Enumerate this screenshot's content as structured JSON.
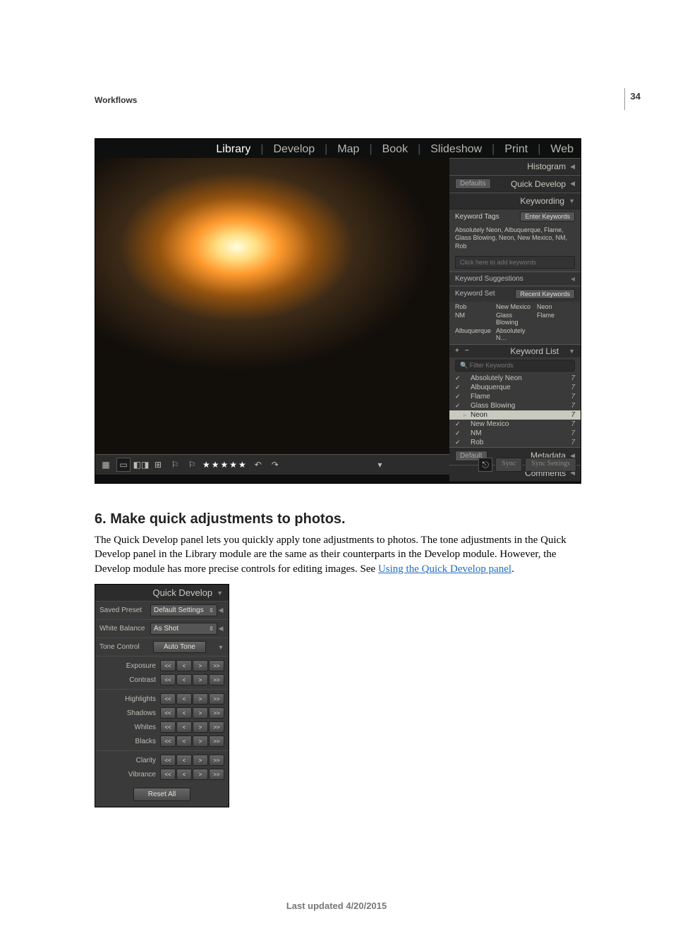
{
  "pagenum": "34",
  "eyebrow": "Workflows",
  "modules": {
    "items": [
      "Library",
      "Develop",
      "Map",
      "Book",
      "Slideshow",
      "Print",
      "Web"
    ],
    "selected": "Library",
    "sep": "|"
  },
  "rpanels": {
    "histogram": {
      "title": "Histogram",
      "tri": "◀"
    },
    "quickdev": {
      "title": "Quick Develop",
      "left_label": "Defaults",
      "tri": "◀"
    },
    "keywording": {
      "title": "Keywording",
      "tri": "▼",
      "tags_label": "Keyword Tags",
      "enter_btn": "Enter Keywords",
      "applied": "Absolutely Neon, Albuquerque, Flame, Glass Blowing, Neon, New Mexico, NM, Rob",
      "add_placeholder": "Click here to add keywords",
      "suggestions_label": "Keyword Suggestions",
      "set_label": "Keyword Set",
      "set_btn": "Recent Keywords",
      "set_items": [
        "Rob",
        "New Mexico",
        "Neon",
        "NM",
        "Glass Blowing",
        "Flame",
        "Albuquerque",
        "Absolutely N…",
        ""
      ]
    },
    "keywordlist": {
      "title": "Keyword List",
      "tri": "▼",
      "plus": "+",
      "minus": "−",
      "filter_placeholder": "Filter Keywords",
      "items": [
        {
          "name": "Absolutely Neon",
          "count": "7",
          "checked": true,
          "sel": false
        },
        {
          "name": "Albuquerque",
          "count": "7",
          "checked": true,
          "sel": false
        },
        {
          "name": "Flame",
          "count": "7",
          "checked": true,
          "sel": false
        },
        {
          "name": "Glass Blowing",
          "count": "7",
          "checked": true,
          "sel": false
        },
        {
          "name": "Neon",
          "count": "7",
          "checked": true,
          "sel": true,
          "arrow": "▹"
        },
        {
          "name": "New Mexico",
          "count": "7",
          "checked": true,
          "sel": false
        },
        {
          "name": "NM",
          "count": "7",
          "checked": true,
          "sel": false
        },
        {
          "name": "Rob",
          "count": "7",
          "checked": true,
          "sel": false
        }
      ]
    },
    "metadata": {
      "title": "Metadata",
      "left_label": "Default",
      "tri": "◀"
    },
    "comments": {
      "title": "Comments",
      "tri": "◀"
    }
  },
  "toolbar": {
    "stars": "★★★★★",
    "sync_label": "Sync",
    "sync_settings": "Sync Settings"
  },
  "heading": "6. Make quick adjustments to photos.",
  "para": {
    "t1": "The Quick Develop panel lets you quickly apply tone adjustments to photos. The tone adjustments in the Quick Develop panel in the Library module are the same as their counterparts in the Develop module. However, the Develop module has more precise controls for editing images. See ",
    "link": "Using the Quick Develop panel",
    "t2": "."
  },
  "qdpanel": {
    "title": "Quick Develop",
    "tri": "▼",
    "saved_preset_label": "Saved Preset",
    "saved_preset_value": "Default Settings",
    "wb_label": "White Balance",
    "wb_value": "As Shot",
    "tone_label": "Tone Control",
    "autotone": "Auto Tone",
    "steps": {
      "ll": "<<",
      "l": "<",
      "r": ">",
      "rr": ">>"
    },
    "adjust": [
      "Exposure",
      "Contrast",
      "Highlights",
      "Shadows",
      "Whites",
      "Blacks",
      "Clarity",
      "Vibrance"
    ],
    "reset": "Reset All"
  },
  "footer": "Last updated 4/20/2015"
}
